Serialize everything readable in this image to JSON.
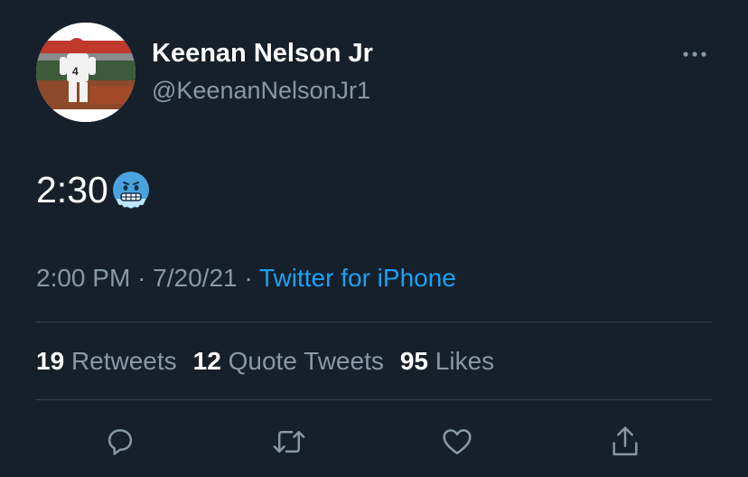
{
  "author": {
    "name": "Keenan Nelson Jr",
    "handle": "@KeenanNelsonJr1",
    "avatar_icon": "profile-photo"
  },
  "tweet": {
    "text": "2:30",
    "emoji": "cold-face-emoji",
    "time": "2:00 PM",
    "separator": "·",
    "date": "7/20/21",
    "source": "Twitter for iPhone"
  },
  "stats": {
    "retweets_count": "19",
    "retweets_label": "Retweets",
    "quotes_count": "12",
    "quotes_label": "Quote Tweets",
    "likes_count": "95",
    "likes_label": "Likes"
  },
  "colors": {
    "background": "#15202b",
    "secondary_text": "#8899a6",
    "accent": "#1da1f2",
    "divider": "#38444d"
  },
  "actions": [
    "reply-icon",
    "retweet-icon",
    "like-icon",
    "share-icon"
  ]
}
